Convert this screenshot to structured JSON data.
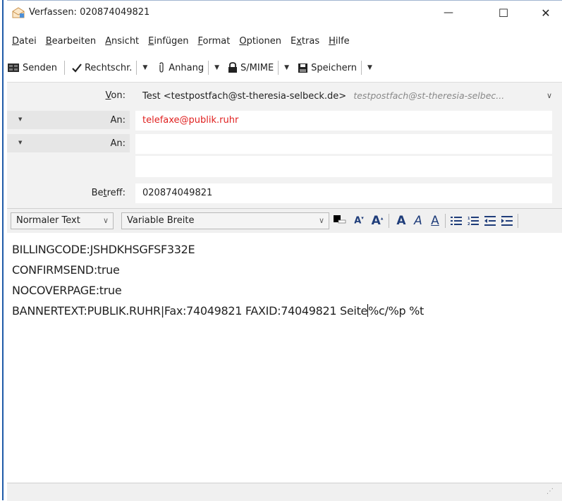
{
  "window": {
    "title": "Verfassen: 020874049821",
    "minimize": "—",
    "maximize": "☐",
    "close": "✕"
  },
  "menu": {
    "items": [
      {
        "u": "D",
        "rest": "atei"
      },
      {
        "u": "B",
        "rest": "earbeiten"
      },
      {
        "u": "A",
        "rest": "nsicht"
      },
      {
        "u": "E",
        "rest": "infügen"
      },
      {
        "u": "F",
        "rest": "ormat"
      },
      {
        "u": "O",
        "rest": "ptionen"
      },
      {
        "pre": "E",
        "u": "x",
        "rest": "tras"
      },
      {
        "u": "H",
        "rest": "ilfe"
      }
    ]
  },
  "toolbar": {
    "send": "Senden",
    "spell": "Rechtschr.",
    "attach": "Anhang",
    "smime": "S/MIME",
    "save": "Speichern"
  },
  "headers": {
    "from_label_u": "V",
    "from_label_rest": "on:",
    "from_value": "Test <testpostfach@st-theresia-selbeck.de>",
    "from_hint": "testpostfach@st-theresia-selbec...",
    "to_label": "An:",
    "to_value": "telefaxe@publik.ruhr",
    "to2_label": "An:",
    "to2_value": "",
    "subject_label_pre": "Be",
    "subject_label_u": "t",
    "subject_label_rest": "reff:",
    "subject_value": "020874049821"
  },
  "format": {
    "paragraph": "Normaler Text",
    "font": "Variable Breite"
  },
  "body": {
    "line1": "BILLINGCODE:JSHDKHSGFSF332E",
    "line2": "CONFIRMSEND:true",
    "line3": "NOCOVERPAGE:true",
    "line4a": "BANNERTEXT:PUBLIK.RUHR|Fax:74049821 FAXID:74049821 Seite",
    "line4b": "%c/%p %t"
  },
  "colors": {
    "recipient": "#e0201f",
    "accent": "#1e5aa8"
  }
}
